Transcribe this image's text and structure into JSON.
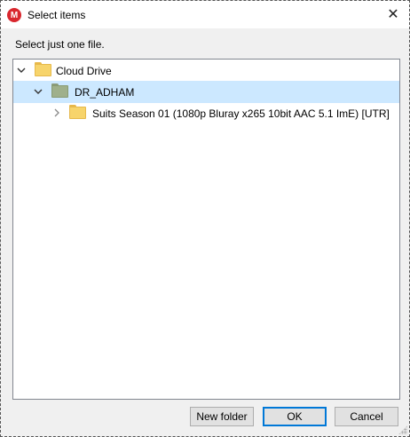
{
  "window": {
    "title": "Select items",
    "app_icon_letter": "M",
    "close_glyph": "✕"
  },
  "instruction": "Select just one file.",
  "tree": {
    "items": [
      {
        "label": "Cloud Drive",
        "expanded": true,
        "level": 0,
        "icon": "folder-icon",
        "icon_color": "#f7d46b"
      },
      {
        "label": "DR_ADHAM",
        "expanded": true,
        "level": 1,
        "selected": true,
        "icon": "shared-folder-icon",
        "icon_color": "#9fb08b"
      },
      {
        "label": "Suits Season 01 (1080p Bluray x265 10bit AAC 5.1 ImE) [UTR]",
        "expanded": false,
        "level": 2,
        "icon": "folder-icon",
        "icon_color": "#f7d46b"
      }
    ]
  },
  "buttons": {
    "new_folder": "New folder",
    "ok": "OK",
    "cancel": "Cancel"
  },
  "colors": {
    "selection": "#cce8ff",
    "brand": "#d9272e",
    "default_button_border": "#0078d7"
  }
}
